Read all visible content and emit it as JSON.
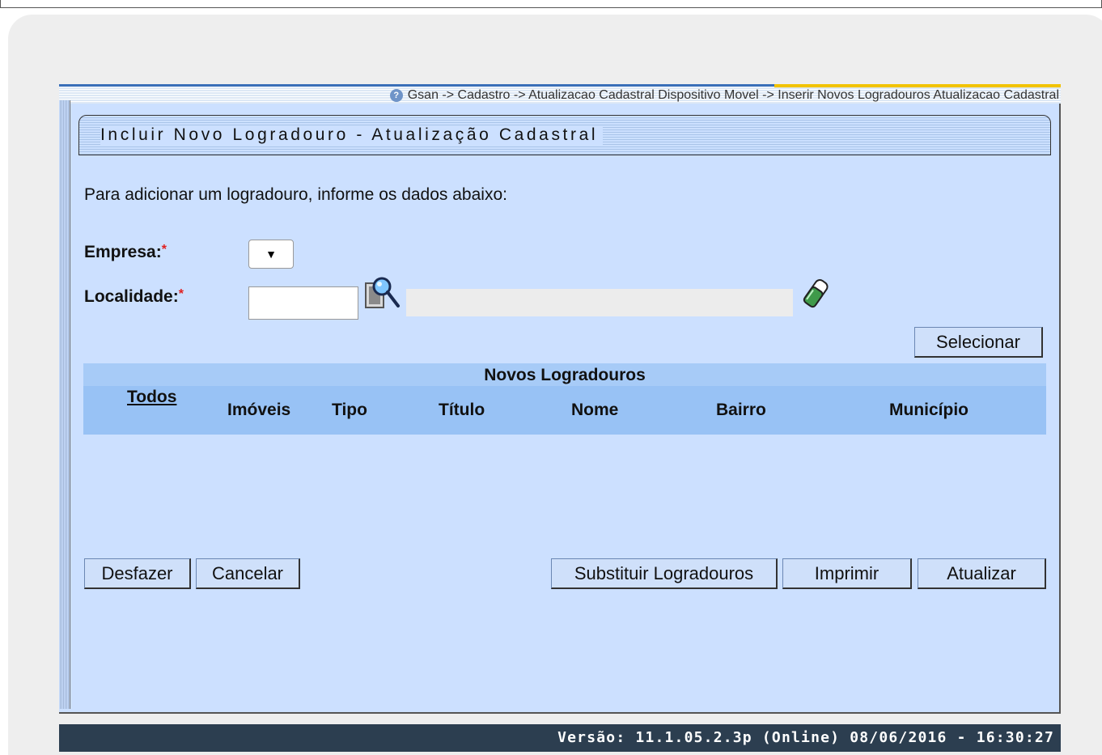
{
  "breadcrumb": "Gsan -> Cadastro -> Atualizacao Cadastral Dispositivo Movel -> Inserir Novos Logradouros Atualizacao Cadastral",
  "page_title": "Incluir Novo Logradouro - Atualização Cadastral",
  "intro": "Para adicionar um logradouro, informe os dados abaixo:",
  "form": {
    "empresa_label": "Empresa:",
    "localidade_label": "Localidade:",
    "required_mark": "*",
    "empresa_select_arrow": "▼",
    "localidade_value": "",
    "localidade_desc": ""
  },
  "buttons": {
    "selecionar": "Selecionar",
    "desfazer": "Desfazer",
    "cancelar": "Cancelar",
    "substituir": "Substituir Logradouros",
    "imprimir": "Imprimir",
    "atualizar": "Atualizar"
  },
  "table": {
    "title": "Novos Logradouros",
    "columns": [
      "Todos",
      "Imóveis",
      "Tipo",
      "Título",
      "Nome",
      "Bairro",
      "Município"
    ],
    "rows": []
  },
  "footer": {
    "version": "Versão: 11.1.05.2.3p (Online) 08/06/2016 - 16:30:27"
  },
  "icons": {
    "help": "help-icon",
    "search": "magnifier-search-icon",
    "eraser": "eraser-icon"
  },
  "colors": {
    "panel_bg": "#cce0ff",
    "table_header": "#98c2f5",
    "footer_bg": "#2c3e50",
    "required": "#e02020"
  }
}
